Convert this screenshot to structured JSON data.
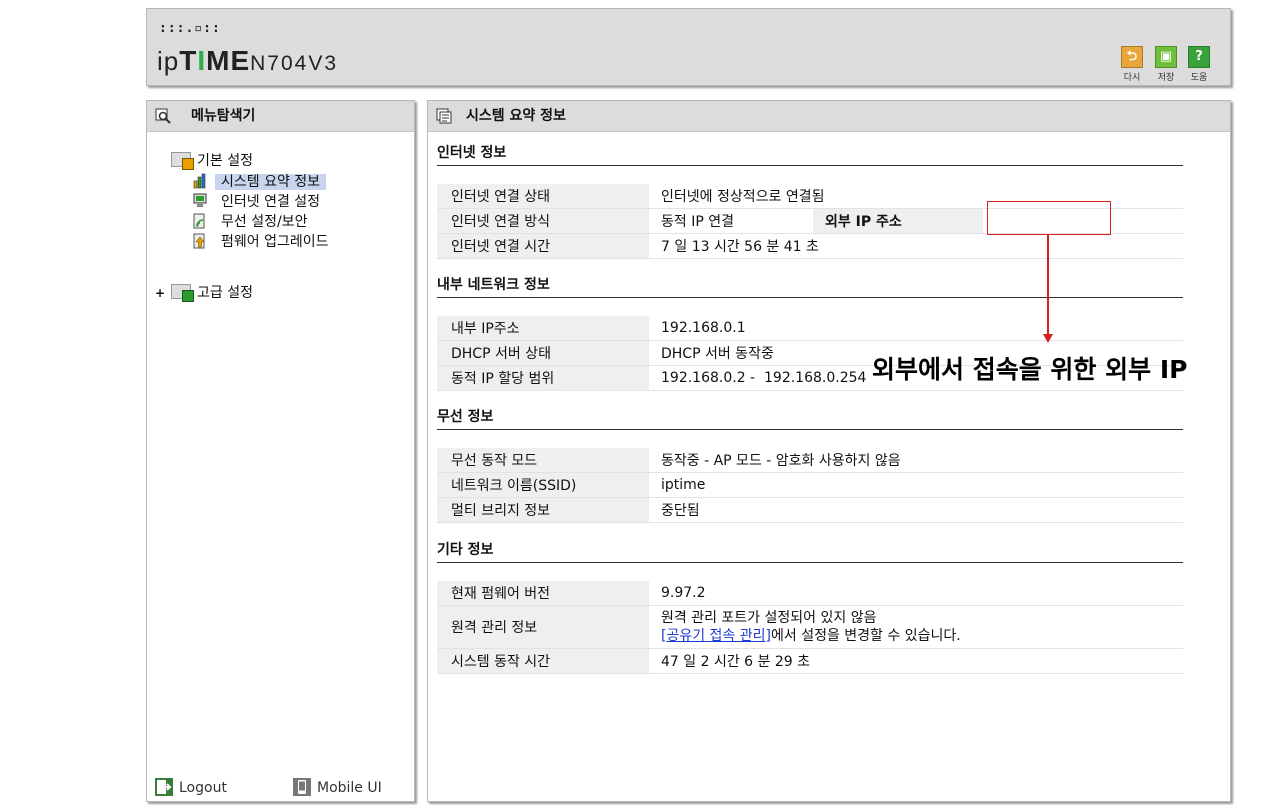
{
  "header": {
    "logo_dots": ":::.▫::",
    "brand_ip": "ip",
    "brand_t": "T",
    "brand_i": "I",
    "brand_me": "ME",
    "model": "N704V3",
    "buttons": [
      {
        "label": "다시",
        "icon": "undo-icon",
        "color": "#e6a63a"
      },
      {
        "label": "저장",
        "icon": "save-icon",
        "color": "#6fbf3a"
      },
      {
        "label": "도움",
        "icon": "help-icon",
        "color": "#3aa23a"
      }
    ]
  },
  "sidebar": {
    "title": "메뉴탐색기",
    "groups": [
      {
        "label": "기본 설정",
        "items": [
          {
            "label": "시스템 요약 정보",
            "selected": true
          },
          {
            "label": "인터넷 연결 설정"
          },
          {
            "label": "무선 설정/보안"
          },
          {
            "label": "펌웨어 업그레이드"
          }
        ]
      },
      {
        "label": "고급 설정",
        "collapsed_marker": "+"
      }
    ],
    "footer": {
      "logout": "Logout",
      "mobile": "Mobile UI"
    }
  },
  "main": {
    "title": "시스템 요약 정보",
    "internet": {
      "heading": "인터넷 정보",
      "rows": [
        {
          "key": "인터넷 연결 상태",
          "value": "인터넷에 정상적으로 연결됨"
        },
        {
          "key": "인터넷 연결 방식",
          "value": "동적 IP 연결",
          "extra_key": "외부 IP 주소",
          "extra_value": ""
        },
        {
          "key": "인터넷 연결 시간",
          "value": "7 일 13 시간 56 분 41 초"
        }
      ]
    },
    "lan": {
      "heading": "내부 네트워크 정보",
      "rows": [
        {
          "key": "내부 IP주소",
          "value": "192.168.0.1"
        },
        {
          "key": "DHCP 서버 상태",
          "value": "DHCP 서버 동작중"
        },
        {
          "key": "동적 IP 할당 범위",
          "value": "192.168.0.2 -  192.168.0.254"
        }
      ]
    },
    "wireless": {
      "heading": "무선 정보",
      "rows": [
        {
          "key": "무선 동작 모드",
          "value": "동작중 - AP 모드 - 암호화 사용하지 않음"
        },
        {
          "key": "네트워크 이름(SSID)",
          "value": "iptime"
        },
        {
          "key": "멀티 브리지 정보",
          "value": "중단됨"
        }
      ]
    },
    "etc": {
      "heading": "기타 정보",
      "rows": [
        {
          "key": "현재 펌웨어 버전",
          "value": "9.97.2"
        },
        {
          "key": "원격 관리 정보",
          "value": "원격 관리 포트가 설정되어 있지 않음",
          "link": "[공유기 접속 관리]",
          "value2": "에서 설정을 변경할 수 있습니다."
        },
        {
          "key": "시스템 동작 시간",
          "value": "47 일 2 시간 6 분 29 초"
        }
      ]
    }
  },
  "annotation": {
    "text": "외부에서 접속을 위한 외부 IP",
    "color": "#d42020"
  }
}
